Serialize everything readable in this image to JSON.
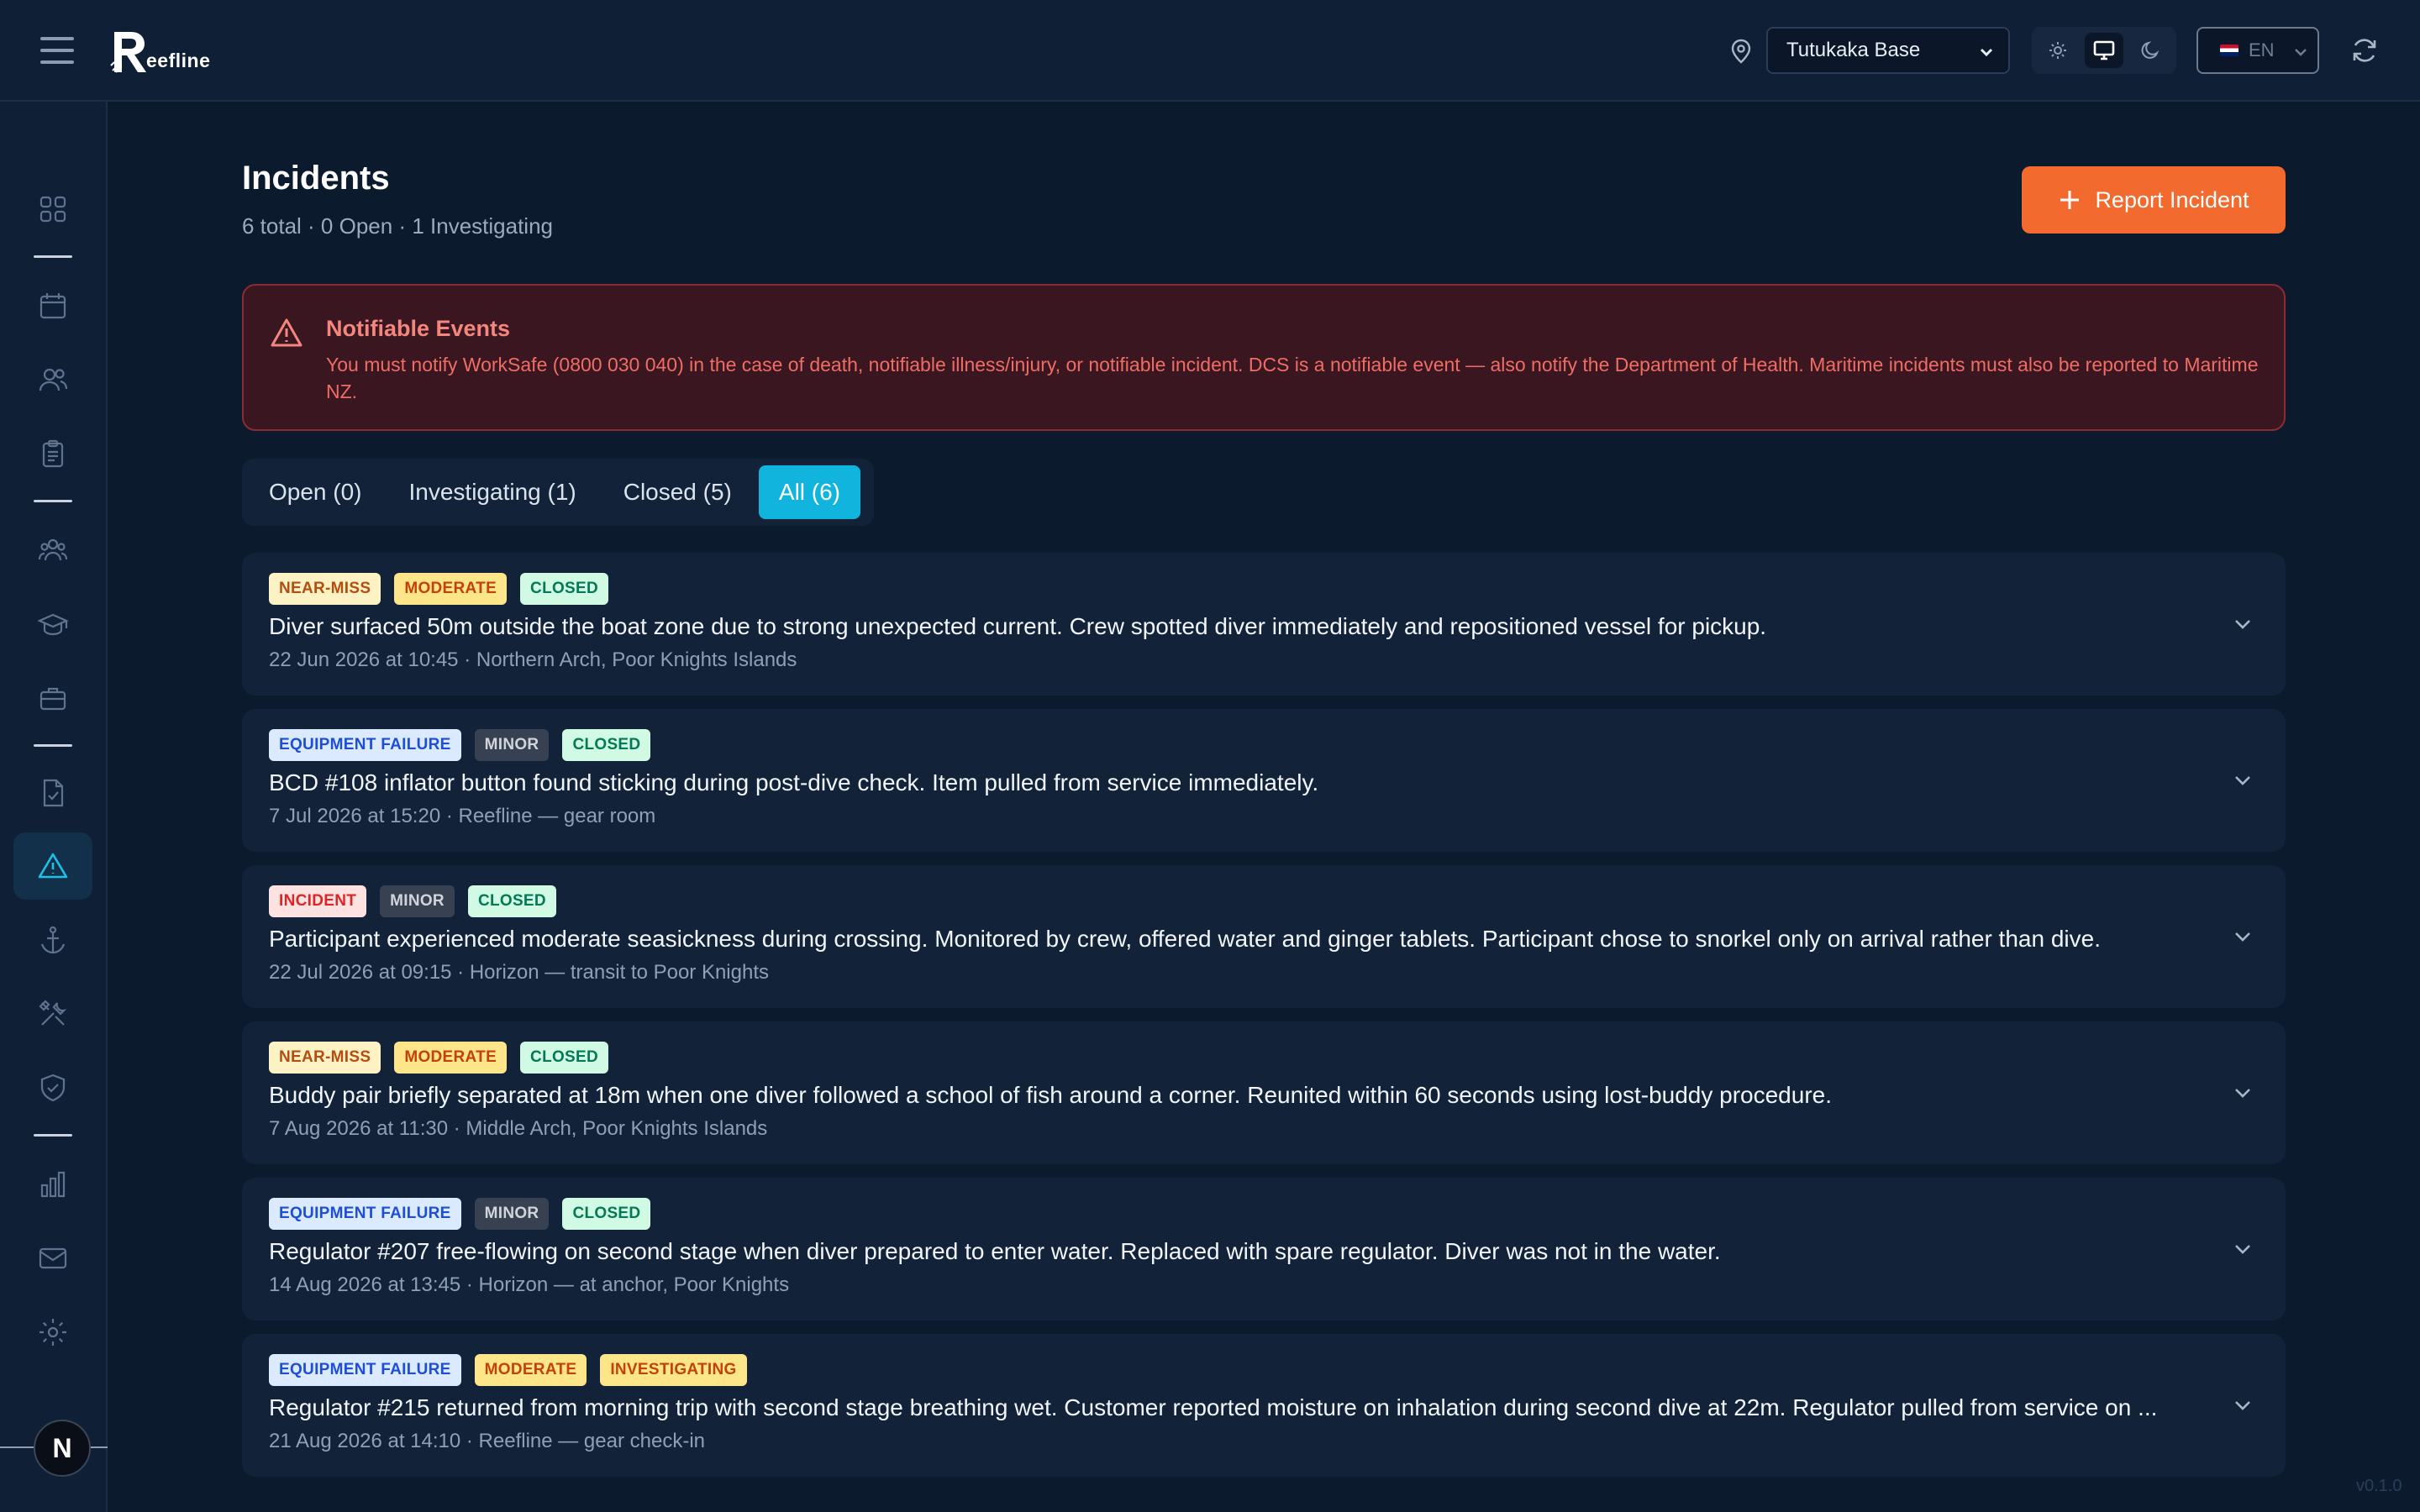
{
  "header": {
    "logo_text": "eefline",
    "location": "Tutukaka Base",
    "language": "EN",
    "icons": [
      "menu-icon",
      "location-pin-icon",
      "sun-icon",
      "monitor-icon",
      "moon-icon",
      "refresh-icon"
    ]
  },
  "sidebar": {
    "items": [
      {
        "name": "dashboard",
        "icon": "grid-icon"
      },
      {
        "name": "calendar",
        "icon": "calendar-icon"
      },
      {
        "name": "customers",
        "icon": "users-icon"
      },
      {
        "name": "bookings",
        "icon": "clipboard-icon"
      },
      {
        "name": "staff",
        "icon": "team-icon"
      },
      {
        "name": "courses",
        "icon": "graduation-cap-icon"
      },
      {
        "name": "inventory",
        "icon": "briefcase-icon"
      },
      {
        "name": "documents",
        "icon": "file-check-icon"
      },
      {
        "name": "incidents",
        "icon": "warning-icon",
        "active": true
      },
      {
        "name": "boats",
        "icon": "anchor-icon"
      },
      {
        "name": "maintenance",
        "icon": "tools-icon"
      },
      {
        "name": "compliance",
        "icon": "shield-check-icon"
      },
      {
        "name": "reports",
        "icon": "bar-chart-icon"
      },
      {
        "name": "messages",
        "icon": "mail-icon"
      },
      {
        "name": "settings",
        "icon": "gear-icon"
      }
    ],
    "avatar_letter": "N"
  },
  "main": {
    "title": "Incidents",
    "subtitle": "6 total · 0 Open · 1 Investigating",
    "report_button": "Report Incident",
    "alert": {
      "title": "Notifiable Events",
      "text": "You must notify WorkSafe (0800 030 040) in the case of death, notifiable illness/injury, or notifiable incident. DCS is a notifiable event — also notify the Department of Health. Maritime incidents must also be reported to Maritime NZ."
    },
    "tabs": [
      {
        "label": "Open (0)",
        "active": false
      },
      {
        "label": "Investigating (1)",
        "active": false
      },
      {
        "label": "Closed (5)",
        "active": false
      },
      {
        "label": "All (6)",
        "active": true
      }
    ],
    "incidents": [
      {
        "badges": [
          {
            "text": "NEAR-MISS",
            "kind": "near"
          },
          {
            "text": "MODERATE",
            "kind": "moderate"
          },
          {
            "text": "CLOSED",
            "kind": "closed"
          }
        ],
        "description": "Diver surfaced 50m outside the boat zone due to strong unexpected current. Crew spotted diver immediately and repositioned vessel for pickup.",
        "meta": "22 Jun 2026 at 10:45 · Northern Arch, Poor Knights Islands"
      },
      {
        "badges": [
          {
            "text": "EQUIPMENT FAILURE",
            "kind": "equip"
          },
          {
            "text": "MINOR",
            "kind": "minor"
          },
          {
            "text": "CLOSED",
            "kind": "closed"
          }
        ],
        "description": "BCD #108 inflator button found sticking during post-dive check. Item pulled from service immediately.",
        "meta": "7 Jul 2026 at 15:20 · Reefline — gear room"
      },
      {
        "badges": [
          {
            "text": "INCIDENT",
            "kind": "incident"
          },
          {
            "text": "MINOR",
            "kind": "minor"
          },
          {
            "text": "CLOSED",
            "kind": "closed"
          }
        ],
        "description": "Participant experienced moderate seasickness during crossing. Monitored by crew, offered water and ginger tablets. Participant chose to snorkel only on arrival rather than dive.",
        "meta": "22 Jul 2026 at 09:15 · Horizon — transit to Poor Knights"
      },
      {
        "badges": [
          {
            "text": "NEAR-MISS",
            "kind": "near"
          },
          {
            "text": "MODERATE",
            "kind": "moderate"
          },
          {
            "text": "CLOSED",
            "kind": "closed"
          }
        ],
        "description": "Buddy pair briefly separated at 18m when one diver followed a school of fish around a corner. Reunited within 60 seconds using lost-buddy procedure.",
        "meta": "7 Aug 2026 at 11:30 · Middle Arch, Poor Knights Islands"
      },
      {
        "badges": [
          {
            "text": "EQUIPMENT FAILURE",
            "kind": "equip"
          },
          {
            "text": "MINOR",
            "kind": "minor"
          },
          {
            "text": "CLOSED",
            "kind": "closed"
          }
        ],
        "description": "Regulator #207 free-flowing on second stage when diver prepared to enter water. Replaced with spare regulator. Diver was not in the water.",
        "meta": "14 Aug 2026 at 13:45 · Horizon — at anchor, Poor Knights"
      },
      {
        "badges": [
          {
            "text": "EQUIPMENT FAILURE",
            "kind": "equip"
          },
          {
            "text": "MODERATE",
            "kind": "moderate"
          },
          {
            "text": "INVESTIGATING",
            "kind": "invest"
          }
        ],
        "description": "Regulator #215 returned from morning trip with second stage breathing wet. Customer reported moisture on inhalation during second dive at 22m. Regulator pulled from service on ...",
        "meta": "21 Aug 2026 at 14:10 · Reefline — gear check-in"
      }
    ],
    "version": "v0.1.0"
  }
}
